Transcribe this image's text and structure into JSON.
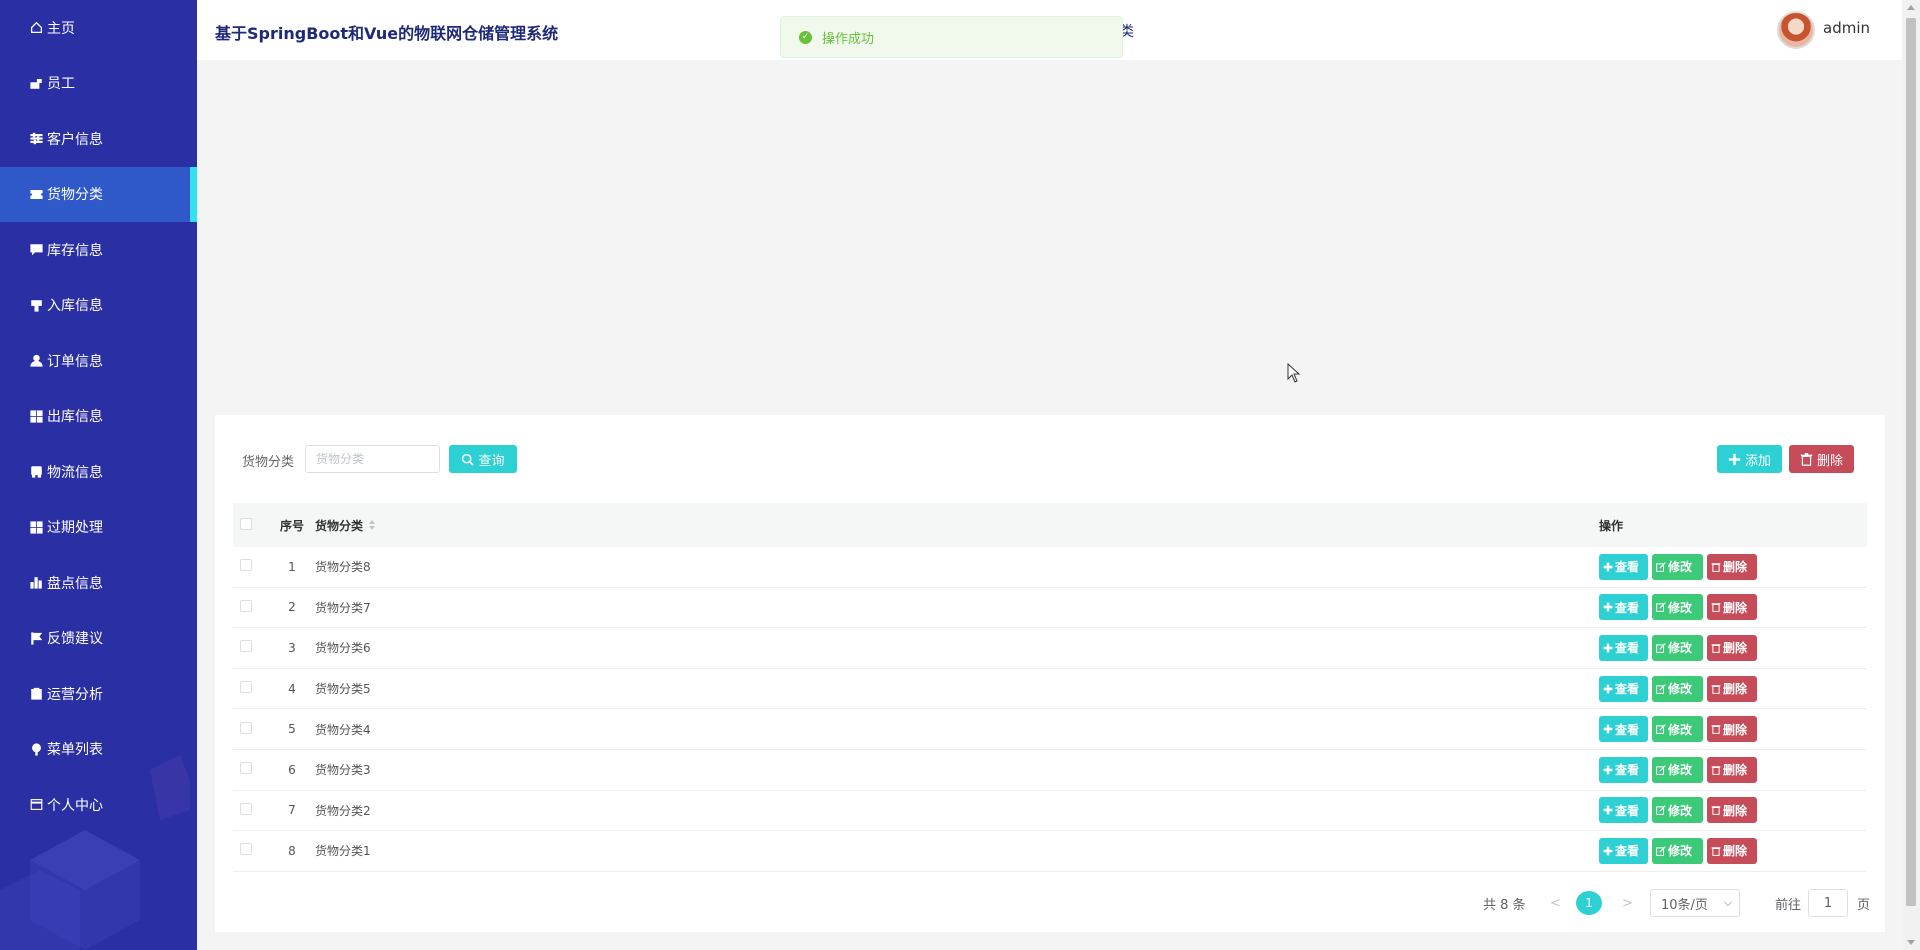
{
  "header": {
    "title": "基于SpringBoot和Vue的物联网仓储管理系统",
    "hidden_fragment": "类",
    "username": "admin"
  },
  "toast": {
    "message": "操作成功"
  },
  "sidebar": {
    "items": [
      {
        "label": "主页",
        "icon": "home-icon"
      },
      {
        "label": "员工",
        "icon": "worker-icon"
      },
      {
        "label": "客户信息",
        "icon": "sliders-icon"
      },
      {
        "label": "货物分类",
        "icon": "ticket-icon",
        "active": true
      },
      {
        "label": "库存信息",
        "icon": "chat-icon"
      },
      {
        "label": "入库信息",
        "icon": "tag-icon"
      },
      {
        "label": "订单信息",
        "icon": "user-icon"
      },
      {
        "label": "出库信息",
        "icon": "grid-icon"
      },
      {
        "label": "物流信息",
        "icon": "truck-icon"
      },
      {
        "label": "过期处理",
        "icon": "grid-icon"
      },
      {
        "label": "盘点信息",
        "icon": "bar-chart-icon"
      },
      {
        "label": "反馈建议",
        "icon": "flag-icon"
      },
      {
        "label": "运营分析",
        "icon": "clipboard-icon"
      },
      {
        "label": "菜单列表",
        "icon": "pin-icon"
      },
      {
        "label": "个人中心",
        "icon": "card-icon"
      }
    ]
  },
  "search": {
    "label": "货物分类",
    "placeholder": "货物分类",
    "query_label": "查询"
  },
  "toolbar": {
    "add_label": "添加",
    "delete_label": "删除"
  },
  "table": {
    "headers": {
      "index": "序号",
      "name": "货物分类",
      "ops": "操作"
    },
    "rows": [
      {
        "index": "1",
        "name": "货物分类8"
      },
      {
        "index": "2",
        "name": "货物分类7"
      },
      {
        "index": "3",
        "name": "货物分类6"
      },
      {
        "index": "4",
        "name": "货物分类5"
      },
      {
        "index": "5",
        "name": "货物分类4"
      },
      {
        "index": "6",
        "name": "货物分类3"
      },
      {
        "index": "7",
        "name": "货物分类2"
      },
      {
        "index": "8",
        "name": "货物分类1"
      }
    ],
    "ops": {
      "view": "查看",
      "edit": "修改",
      "delete": "删除"
    }
  },
  "pagination": {
    "total": "共 8 条",
    "prev": "<",
    "current": "1",
    "next": ">",
    "page_size": "10条/页",
    "goto_label": "前往",
    "goto_value": "1",
    "page_unit": "页"
  },
  "colors": {
    "sidebar_bg": "#2a2fa3",
    "sidebar_active": "#2f58c9",
    "accent_cyan": "#2dd1d3",
    "edit_green": "#3cc978",
    "delete_red": "#c64c59",
    "toast_green": "#67c23a"
  }
}
